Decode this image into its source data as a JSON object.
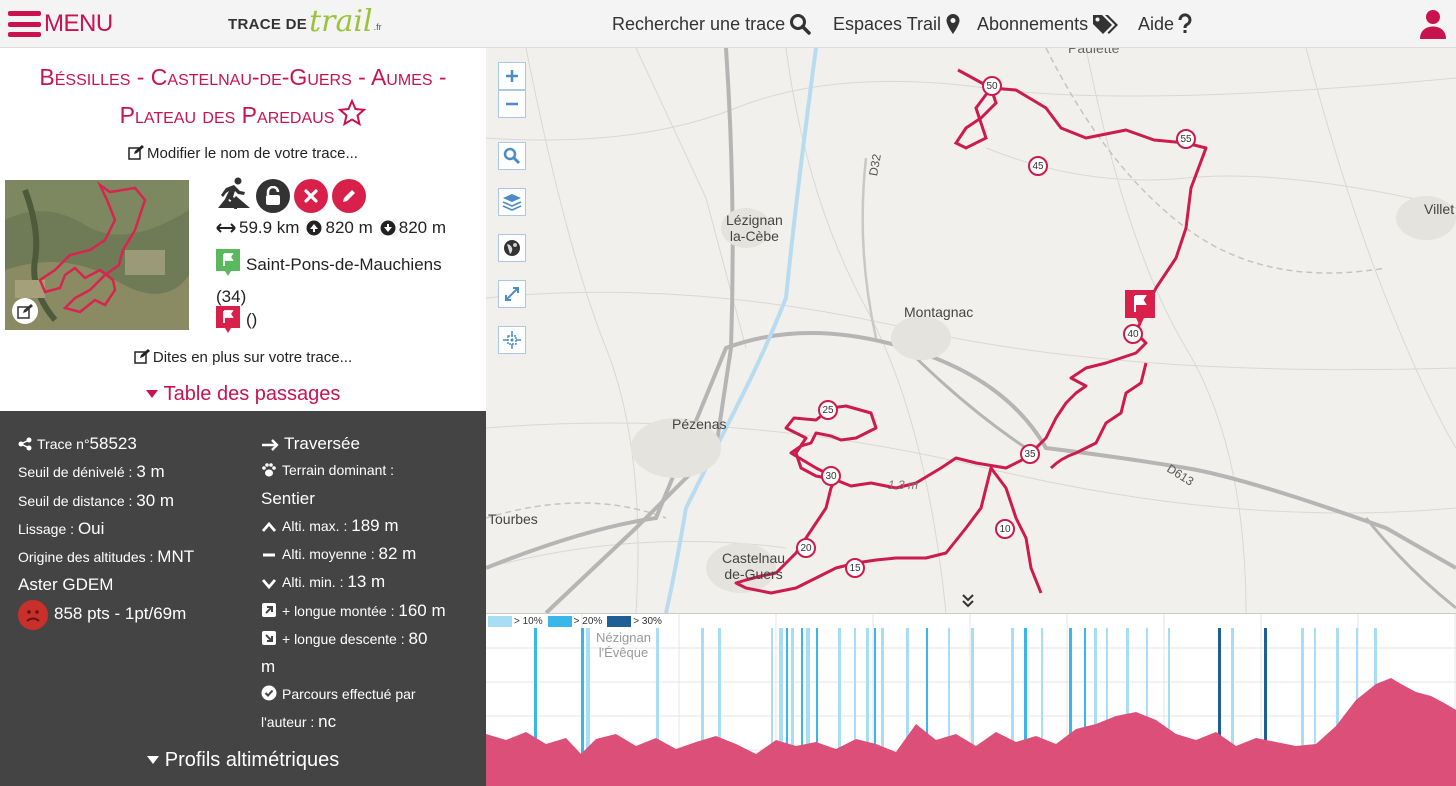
{
  "header": {
    "menu_label": "MENU",
    "logo_trace": "TRACE DE",
    "logo_trail": "trail",
    "logo_tld": ".fr",
    "nav": [
      "Rechercher une trace",
      "Espaces Trail",
      "Abonnements",
      "Aide"
    ]
  },
  "trace": {
    "title_line1": "Béssilles - Castelnau-de-Guers - Aumes -",
    "title_line2": "Plateau des Paredaus",
    "edit_name": "Modifier le nom de votre trace...",
    "distance": "59.9 km",
    "ascent": "820 m",
    "descent": "820 m",
    "start_place": "Saint-Pons-de-Mauchiens",
    "start_dept": "(34)",
    "end_place": "()",
    "more_info": "Dites en plus sur votre trace...",
    "passages_title": "Table des passages"
  },
  "details": {
    "trace_label": "Trace n°",
    "trace_number": "58523",
    "seuil_deniv_label": "Seuil de dénivelé :",
    "seuil_deniv_value": "3 m",
    "seuil_dist_label": "Seuil de distance :",
    "seuil_dist_value": "30 m",
    "lissage_label": "Lissage :",
    "lissage_value": "Oui",
    "origine_label": "Origine des altitudes :",
    "origine_value_a": "MNT",
    "origine_value_b": "Aster GDEM",
    "points": "858 pts - 1pt/69m",
    "type": "Traversée",
    "terrain_label": "Terrain dominant :",
    "terrain_value": "Sentier",
    "alt_max_label": "Alti. max. :",
    "alt_max_value": "189 m",
    "alt_moy_label": "Alti. moyenne :",
    "alt_moy_value": "82 m",
    "alt_min_label": "Alti. min. :",
    "alt_min_value": "13 m",
    "longue_montee_label": "+ longue montée :",
    "longue_montee_value": "160 m",
    "longue_descente_label": "+ longue descente :",
    "longue_descente_value": "80",
    "longue_descente_unit": "m",
    "effectue_label": "Parcours effectué par",
    "auteur_label": "l'auteur :",
    "auteur_value": "nc",
    "profils_title": "Profils altimétriques"
  },
  "map": {
    "places": [
      "Lézignan",
      "la-Cèbe",
      "Montagnac",
      "Pézenas",
      "Tourbes",
      "Castelnau",
      "de-Guers",
      "Villet",
      "Paulette",
      "Nézignan",
      "l'Évêque"
    ],
    "roads": [
      "D32",
      "D613",
      "1.3 m"
    ],
    "km_markers": [
      "50",
      "55",
      "45",
      "40",
      "35",
      "25",
      "30",
      "20",
      "15",
      "10"
    ]
  },
  "profile": {
    "legend": [
      "> 10%",
      "> 20%",
      "> 30%"
    ],
    "colors": {
      "p10": "#a8def5",
      "p20": "#39b6ea",
      "p30": "#1e5f95",
      "fill": "#dc4f78"
    }
  },
  "colors": {
    "accent": "#c8134f",
    "dark_panel": "#444444",
    "header_bg": "#f4f4f4"
  }
}
